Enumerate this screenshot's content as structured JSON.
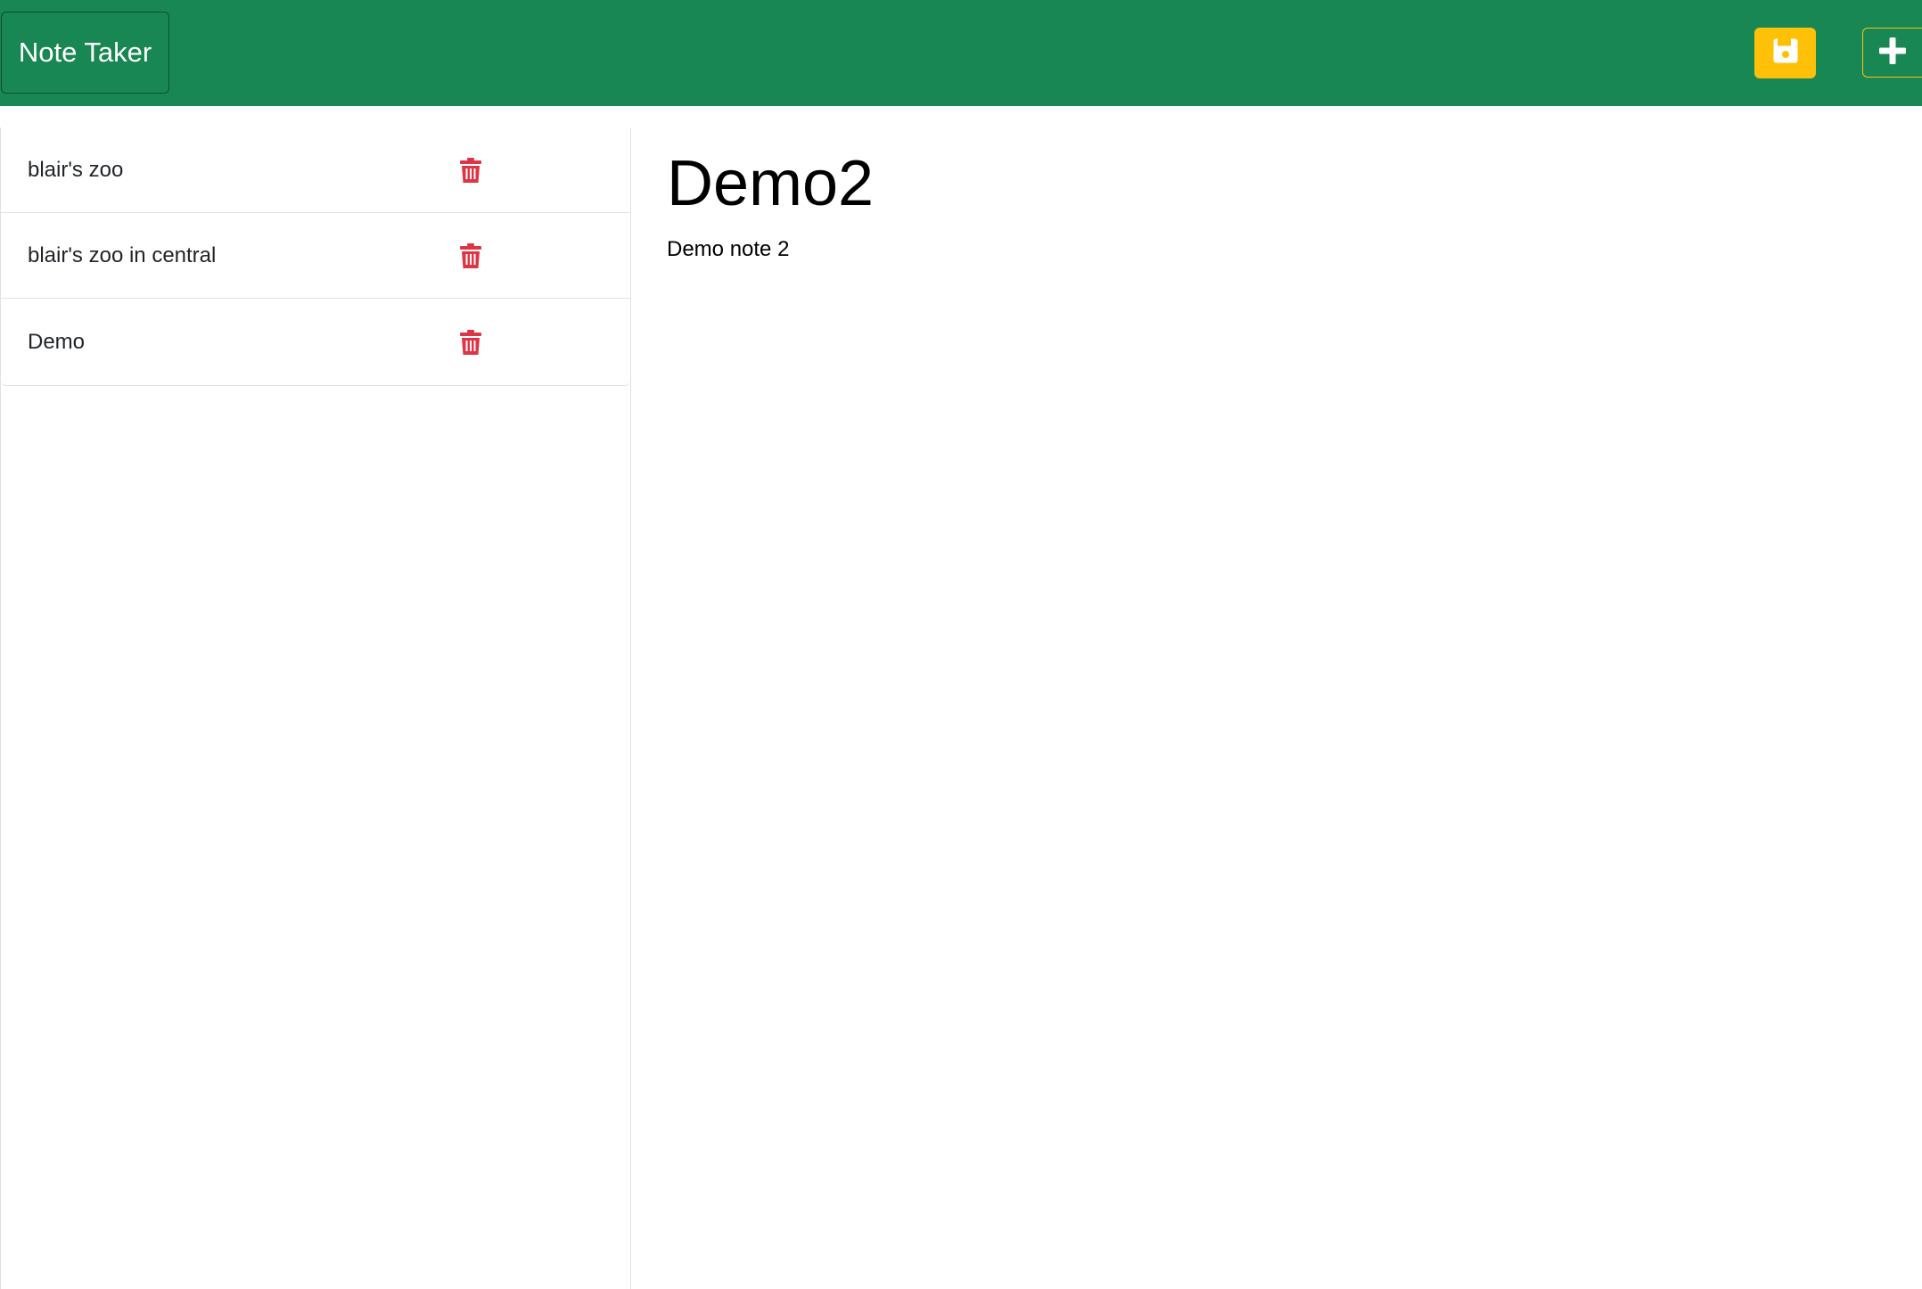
{
  "header": {
    "brand": "Note Taker",
    "save_icon": "floppy-disk-icon",
    "new_icon": "plus-icon"
  },
  "sidebar": {
    "notes": [
      {
        "title": "blair's zoo",
        "delete_icon": "trash-icon"
      },
      {
        "title": "blair's zoo in central",
        "delete_icon": "trash-icon"
      },
      {
        "title": "Demo",
        "delete_icon": "trash-icon"
      }
    ]
  },
  "editor": {
    "title": "Demo2",
    "body": "Demo note 2"
  },
  "colors": {
    "navbar": "#198754",
    "save_button": "#ffc107",
    "delete_icon": "#dc3545"
  }
}
